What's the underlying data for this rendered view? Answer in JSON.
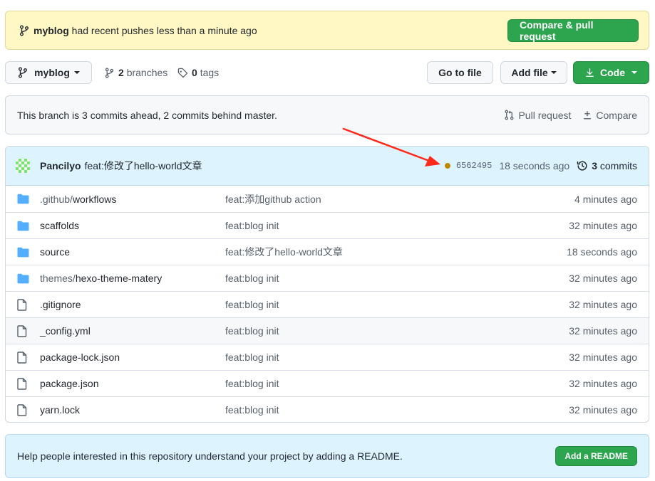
{
  "banner": {
    "branch": "myblog",
    "message": "had recent pushes less than a minute ago",
    "button": "Compare & pull request"
  },
  "toolbar": {
    "branch_selector": "myblog",
    "branches_count": "2",
    "branches_label": "branches",
    "tags_count": "0",
    "tags_label": "tags",
    "go_to_file": "Go to file",
    "add_file": "Add file",
    "code": "Code"
  },
  "ahead_bar": {
    "message": "This branch is 3 commits ahead, 2 commits behind master.",
    "pull_request": "Pull request",
    "compare": "Compare"
  },
  "latest_commit": {
    "author": "Pancilyo",
    "message": "feat:修改了hello-world文章",
    "sha": "6562495",
    "time": "18 seconds ago",
    "commits_count": "3",
    "commits_label": "commits",
    "status_color": "#bf8700"
  },
  "files": [
    {
      "type": "folder",
      "dir": ".github/",
      "name": "workflows",
      "message": "feat:添加github action",
      "age": "4 minutes ago"
    },
    {
      "type": "folder",
      "dir": "",
      "name": "scaffolds",
      "message": "feat:blog init",
      "age": "32 minutes ago"
    },
    {
      "type": "folder",
      "dir": "",
      "name": "source",
      "message": "feat:修改了hello-world文章",
      "age": "18 seconds ago"
    },
    {
      "type": "folder",
      "dir": "themes/",
      "name": "hexo-theme-matery",
      "message": "feat:blog init",
      "age": "32 minutes ago"
    },
    {
      "type": "file",
      "dir": "",
      "name": ".gitignore",
      "message": "feat:blog init",
      "age": "32 minutes ago"
    },
    {
      "type": "file",
      "dir": "",
      "name": "_config.yml",
      "message": "feat:blog init",
      "age": "32 minutes ago"
    },
    {
      "type": "file",
      "dir": "",
      "name": "package-lock.json",
      "message": "feat:blog init",
      "age": "32 minutes ago"
    },
    {
      "type": "file",
      "dir": "",
      "name": "package.json",
      "message": "feat:blog init",
      "age": "32 minutes ago"
    },
    {
      "type": "file",
      "dir": "",
      "name": "yarn.lock",
      "message": "feat:blog init",
      "age": "32 minutes ago"
    }
  ],
  "readme": {
    "message": "Help people interested in this repository understand your project by adding a README.",
    "button": "Add a README"
  },
  "colors": {
    "accent_green": "#2da44e",
    "folder_blue": "#54aeff",
    "arrow_red": "#ff2a1a"
  }
}
